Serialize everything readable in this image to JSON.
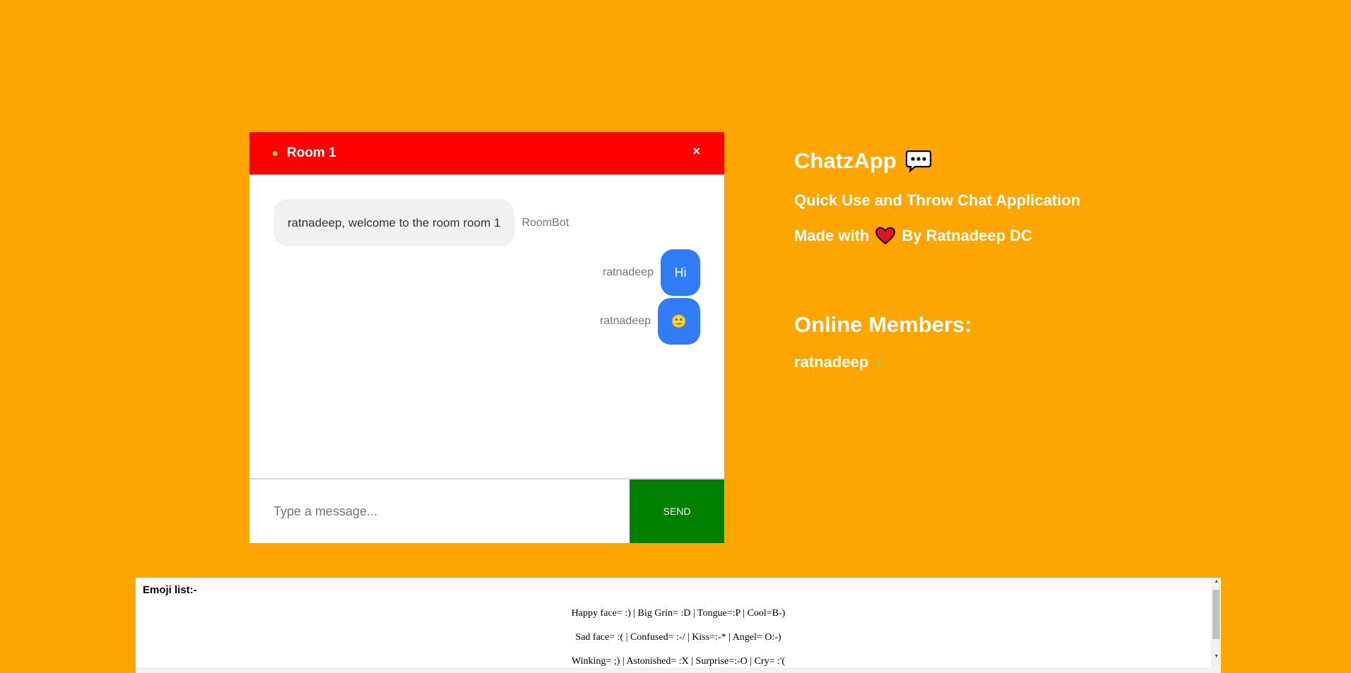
{
  "chat": {
    "room_name": "Room 1",
    "close_label": "×",
    "messages": [
      {
        "text": "ratnadeep, welcome to the room room 1",
        "sender": "RoomBot",
        "side": "left"
      },
      {
        "text": "Hi",
        "sender": "ratnadeep",
        "side": "right"
      },
      {
        "text": "🙂",
        "sender": "ratnadeep",
        "side": "right"
      }
    ],
    "input_placeholder": "Type a message...",
    "send_label": "SEND",
    "colors": {
      "header": "#ff0000",
      "send": "#008000",
      "own_bubble": "#2f7cf6"
    }
  },
  "info": {
    "app_title": "ChatzApp",
    "tagline": "Quick Use and Throw Chat Application",
    "made_with_prefix": "Made with",
    "made_with_suffix": "By Ratnadeep DC",
    "icons": [
      "speech-bubble-icon",
      "heart-icon"
    ],
    "members_title": "Online Members:",
    "members": [
      "ratnadeep"
    ]
  },
  "emoji_list": {
    "heading": "Emoji list:-",
    "lines": [
      "Happy face= :) | Big Grin= :D | Tongue=:P | Cool=B-)",
      "Sad face= :( | Confused= :-/ | Kiss=:-* | Angel= O:-)",
      "Winking= ;) | Astonished= :X | Surprise=:-O | Cry= :'("
    ]
  }
}
